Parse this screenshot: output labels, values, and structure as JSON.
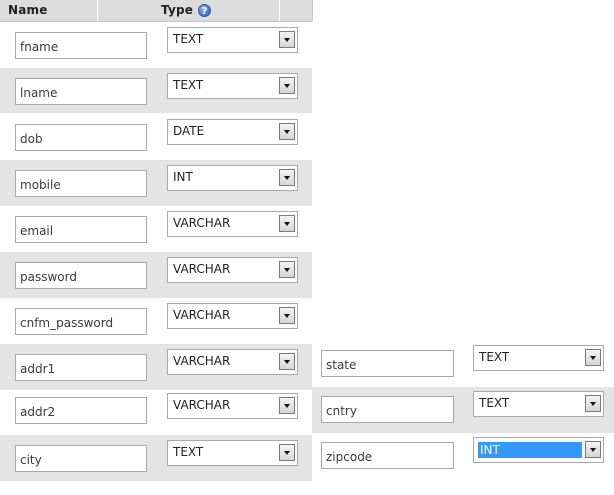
{
  "header": {
    "name_label": "Name",
    "type_label": "Type",
    "help_icon": "help-question-icon",
    "help_glyph": "?"
  },
  "rows": [
    {
      "name": "fname",
      "type": "TEXT"
    },
    {
      "name": "lname",
      "type": "TEXT"
    },
    {
      "name": "dob",
      "type": "DATE"
    },
    {
      "name": "mobile",
      "type": "INT"
    },
    {
      "name": "email",
      "type": "VARCHAR"
    },
    {
      "name": "password",
      "type": "VARCHAR"
    },
    {
      "name": "cnfm_password",
      "type": "VARCHAR"
    },
    {
      "name": "addr1",
      "type": "VARCHAR"
    },
    {
      "name": "addr2",
      "type": "VARCHAR"
    },
    {
      "name": "city",
      "type": "TEXT"
    }
  ],
  "extra_rows": [
    {
      "name": "state",
      "type": "TEXT"
    },
    {
      "name": "cntry",
      "type": "TEXT"
    },
    {
      "name": "zipcode",
      "type": "INT",
      "selected": true
    }
  ],
  "colors": {
    "header_bg": "#dcdcdc",
    "alt_row_bg": "#e4e4e4",
    "selection_highlight": "#3399ff"
  }
}
